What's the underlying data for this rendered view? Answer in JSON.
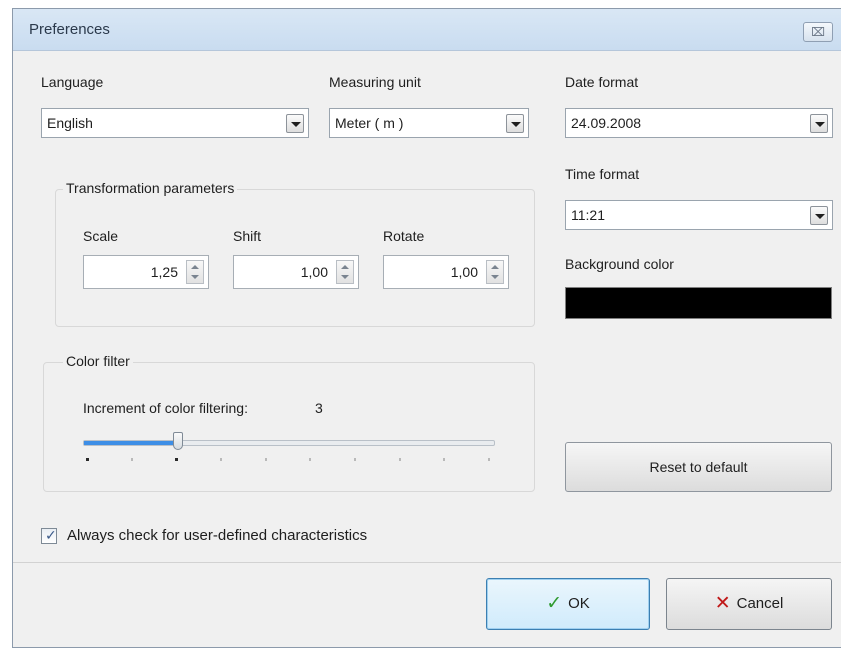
{
  "window": {
    "title": "Preferences",
    "close_glyph": "⌧"
  },
  "language": {
    "label": "Language",
    "value": "English"
  },
  "measuring_unit": {
    "label": "Measuring unit",
    "value": "Meter ( m )"
  },
  "date_format": {
    "label": "Date format",
    "value": "24.09.2008"
  },
  "time_format": {
    "label": "Time format",
    "value": "11:21"
  },
  "background_color": {
    "label": "Background color",
    "value": "#000000"
  },
  "transformation": {
    "title": "Transformation parameters",
    "scale": {
      "label": "Scale",
      "value": "1,25"
    },
    "shift": {
      "label": "Shift",
      "value": "1,00"
    },
    "rotate": {
      "label": "Rotate",
      "value": "1,00"
    }
  },
  "color_filter": {
    "title": "Color filter",
    "increment_label": "Increment of color filtering:",
    "increment_value": "3",
    "slider_min": 1,
    "slider_max": 10,
    "slider_value": 3
  },
  "reset_label": "Reset to default",
  "always_check": {
    "label": "Always check for user-defined characteristics",
    "checked": true
  },
  "buttons": {
    "ok_label": "OK",
    "cancel_label": "Cancel"
  },
  "icons": {
    "ok": "check-icon",
    "cancel": "x-icon",
    "close": "close-icon"
  },
  "colors": {
    "accent": "#3d8ee6",
    "ok_icon": "#2f9a2f",
    "cancel_icon": "#c01818"
  }
}
